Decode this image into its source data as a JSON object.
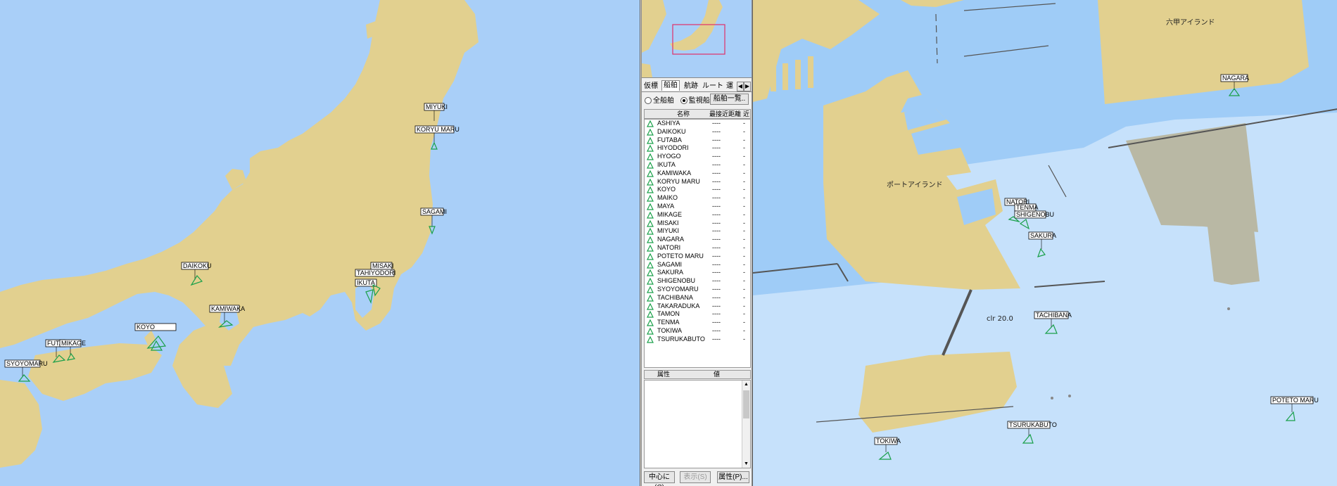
{
  "left_map": {
    "place_labels": [],
    "ships": [
      {
        "name": "MIYUKI"
      },
      {
        "name": "KORYU MARU"
      },
      {
        "name": "SAGAMI"
      },
      {
        "name": "MISAKI"
      },
      {
        "name": "TAKARADUKA"
      },
      {
        "name": "TAMON"
      },
      {
        "name": "IKUTA"
      },
      {
        "name": "DAIKOKU"
      },
      {
        "name": "KAMIWAKA"
      },
      {
        "name": "FUTABA"
      },
      {
        "name": "MIKAGE"
      },
      {
        "name": "SYOYOMARU"
      },
      {
        "name": "TAHIYODORI"
      },
      {
        "name": "KOYO"
      }
    ]
  },
  "overview": {
    "frame": "red"
  },
  "panel": {
    "tabs": [
      "仮標",
      "船舶",
      "航跡",
      "ルート",
      "運"
    ],
    "active_tab": "船舶",
    "radio_all": "全船舶",
    "radio_watch": "監視船",
    "ship_list_button": "船舶一覧..",
    "columns": [
      "名称",
      "最接近距離",
      "近"
    ],
    "ships": [
      "ASHIYA",
      "DAIKOKU",
      "FUTABA",
      "HIYODORI",
      "HYOGO",
      "IKUTA",
      "KAMIWAKA",
      "KORYU MARU",
      "KOYO",
      "MAIKO",
      "MAYA",
      "MIKAGE",
      "MISAKI",
      "MIYUKI",
      "NAGARA",
      "NATORI",
      "POTETO MARU",
      "SAGAMI",
      "SAKURA",
      "SHIGENOBU",
      "SYOYOMARU",
      "TACHIBANA",
      "TAKARADUKA",
      "TAMON",
      "TENMA",
      "TOKIWA",
      "TSURUKABUTO"
    ],
    "dist_placeholder": "----",
    "near_placeholder": "-",
    "prop_columns": [
      "属性",
      "値"
    ],
    "btn_center": "中心に(C)",
    "btn_show": "表示(S)",
    "btn_attr": "属性(P)..."
  },
  "right_map": {
    "port_island": "ポートアイランド",
    "rokko_island": "六甲アイランド",
    "clearance": "clr 20.0",
    "ships": [
      "NAGARA",
      "NATORI",
      "TENMA",
      "SHIGENOBU",
      "SAKURA",
      "TACHIBANA",
      "TSURUKABUTO",
      "TOKIWA",
      "POTETO MARU"
    ]
  },
  "colors": {
    "sea": "#a9cff8",
    "land": "#e2d08f",
    "shallow": "#c9e3fb",
    "ship": "#1aa04a",
    "grey_area": "#b9b8a4"
  }
}
